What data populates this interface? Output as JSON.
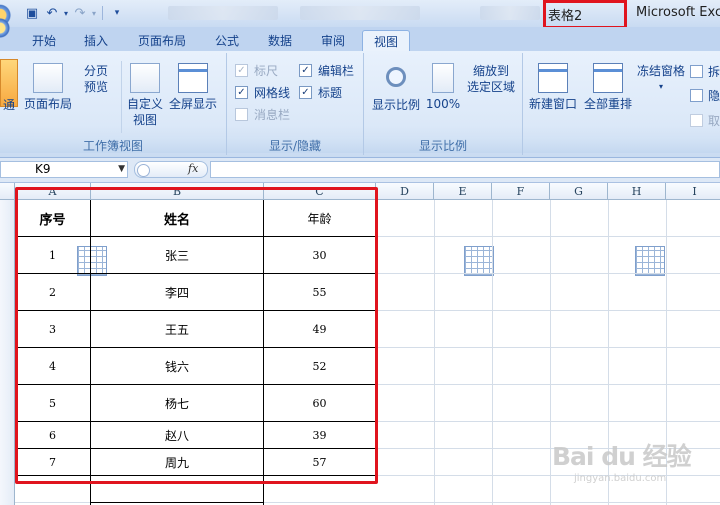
{
  "titlebar": {
    "document_name": "表格2",
    "app_name": "Microsoft Exce"
  },
  "tabs": [
    {
      "label": "开始"
    },
    {
      "label": "插入"
    },
    {
      "label": "页面布局"
    },
    {
      "label": "公式"
    },
    {
      "label": "数据"
    },
    {
      "label": "审阅"
    },
    {
      "label": "视图",
      "active": true
    }
  ],
  "ribbon": {
    "workbook_views": {
      "normal": "通",
      "page_layout": "页面布局",
      "page_break_preview": [
        "分页",
        "预览"
      ],
      "custom_views": [
        "自定义",
        "视图"
      ],
      "full_screen": "全屏显示",
      "label": "工作簿视图"
    },
    "show_hide": {
      "ruler": "标尺",
      "gridlines": "网格线",
      "message_bar": "消息栏",
      "formula_bar": "编辑栏",
      "headings": "标题",
      "label": "显示/隐藏"
    },
    "zoom": {
      "zoom": "显示比例",
      "hundred": "100%",
      "zoom_to_selection": [
        "缩放到",
        "选定区域"
      ],
      "label": "显示比例"
    },
    "window": {
      "new_window": "新建窗口",
      "arrange_all": "全部重排",
      "freeze_panes": "冻结窗格",
      "split": "拆",
      "hide": "隐",
      "unhide": "取"
    }
  },
  "formula_bar": {
    "name_box": "K9",
    "fx_label": "fx",
    "formula": ""
  },
  "columns": [
    "A",
    "B",
    "C",
    "D",
    "E",
    "F",
    "G",
    "H",
    "I"
  ],
  "table": {
    "headers": [
      "序号",
      "姓名",
      "年龄"
    ],
    "rows": [
      [
        "1",
        "张三",
        "30"
      ],
      [
        "2",
        "李四",
        "55"
      ],
      [
        "3",
        "王五",
        "49"
      ],
      [
        "4",
        "钱六",
        "52"
      ],
      [
        "5",
        "杨七",
        "60"
      ],
      [
        "6",
        "赵八",
        "39"
      ],
      [
        "7",
        "周九",
        "57"
      ]
    ]
  },
  "watermark": {
    "brand": "Bai du 经验",
    "url": "jingyan.baidu.com"
  },
  "colors": {
    "highlight_box": "#e0141e",
    "ribbon_text": "#15428b"
  }
}
